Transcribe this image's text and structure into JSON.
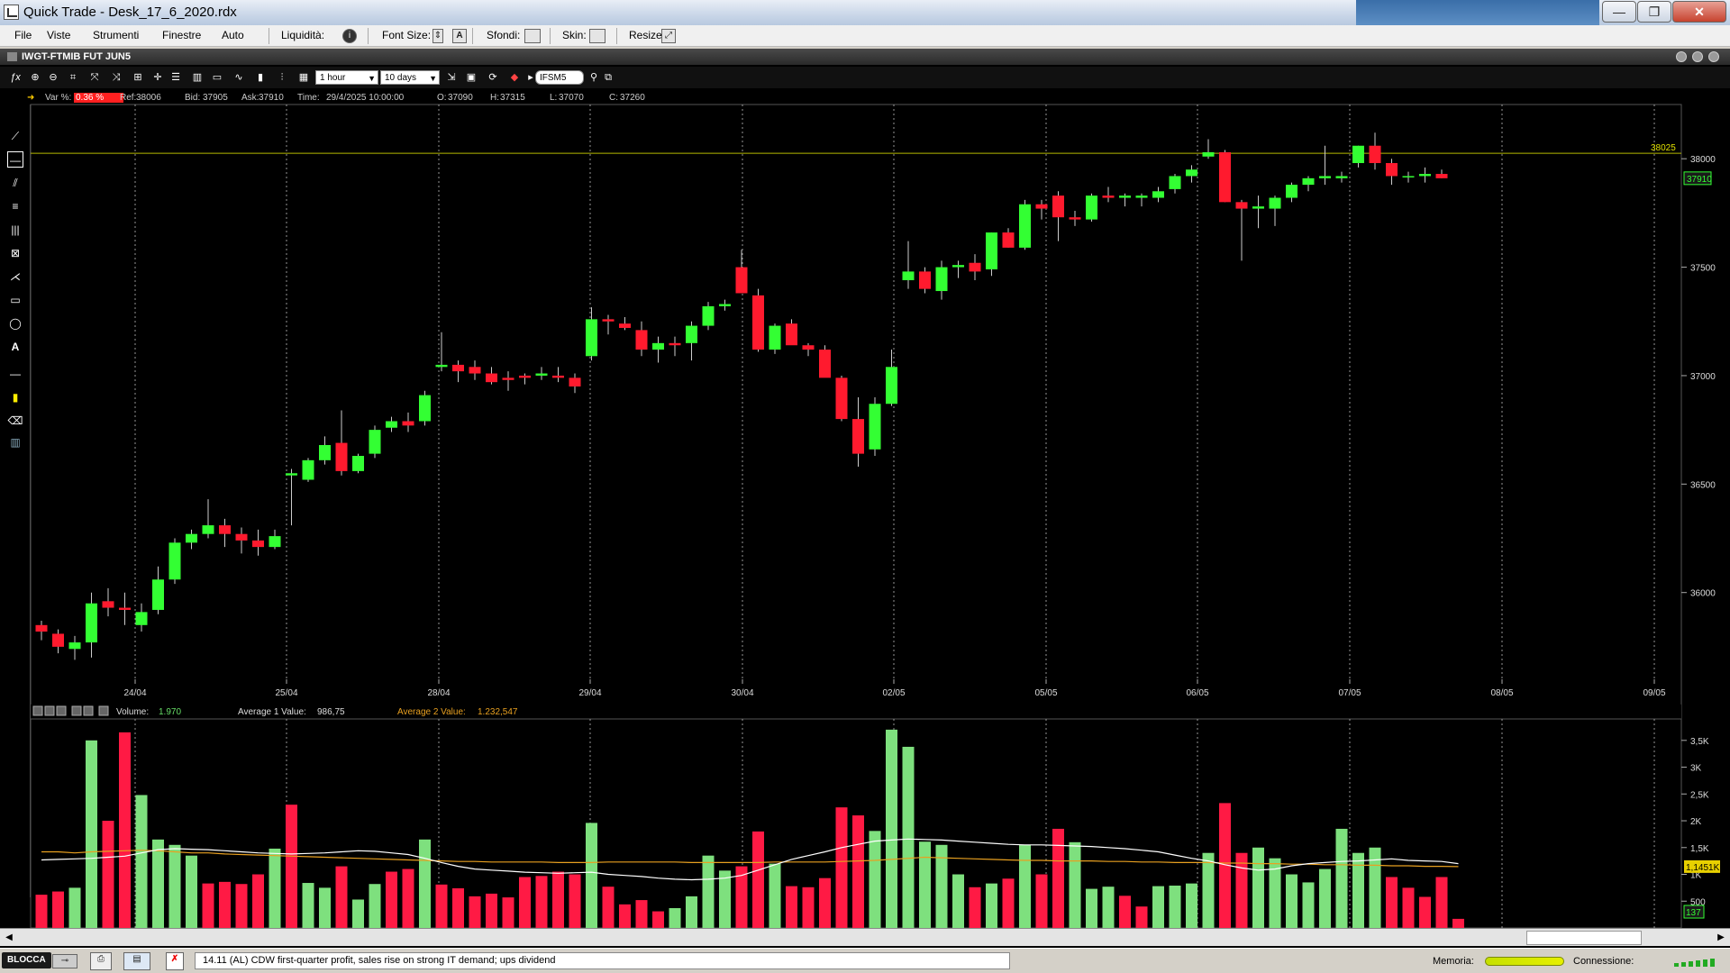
{
  "window": {
    "title": "Quick Trade - Desk_17_6_2020.rdx",
    "min_label": "—",
    "max_label": "❐",
    "close_label": "✕"
  },
  "menu": {
    "items": [
      "File",
      "Viste",
      "Strumenti",
      "Finestre",
      "Auto"
    ],
    "liquidita_label": "Liquidità:",
    "font_size_label": "Font Size:",
    "sfondi_label": "Sfondi:",
    "skin_label": "Skin:",
    "resize_label": "Resize:"
  },
  "chart_window": {
    "title": "IWGT-FTMIB FUT JUN5",
    "interval": "1 hour",
    "range": "10 days",
    "symbol": "IFSM5"
  },
  "info": {
    "var_label": "Var %:",
    "var_value": "0.36 %",
    "ref_label": "Ref:",
    "ref_value": "38006",
    "bid_label": "Bid:",
    "bid_value": "37905",
    "ask_label": "Ask:",
    "ask_value": "37910",
    "time_label": "Time:",
    "time_value": "29/4/2025 10:00:00",
    "o_label": "O:",
    "o_value": "37090",
    "h_label": "H:",
    "h_value": "37315",
    "l_label": "L:",
    "l_value": "37070",
    "c_label": "C:",
    "c_value": "37260"
  },
  "volume_info": {
    "volume_label": "Volume:",
    "volume_value": "1.970",
    "avg1_label": "Average 1 Value:",
    "avg1_value": "986,75",
    "avg2_label": "Average 2 Value:",
    "avg2_value": "1.232,547"
  },
  "colors": {
    "up": "#33ff33",
    "down": "#ff1a2e",
    "vol_up": "#7ee07e",
    "vol_down": "#ff1a44",
    "refline": "#b5b800",
    "avg1": "#ffffff",
    "avg2": "#e8a020"
  },
  "chart_data": [
    {
      "type": "candlestick",
      "y_ticks": [
        "38000",
        "37500",
        "37000",
        "36500",
        "36000"
      ],
      "ylim": [
        35600,
        38250
      ],
      "x_ticks": [
        "24/04",
        "25/04",
        "28/04",
        "29/04",
        "30/04",
        "02/05",
        "05/05",
        "06/05",
        "07/05",
        "08/05",
        "09/05"
      ],
      "ref_line": {
        "value": 38025,
        "label": "38025"
      },
      "last_price": {
        "value": 37910,
        "label": "37910"
      },
      "candles": [
        {
          "o": 35850,
          "h": 35870,
          "l": 35780,
          "c": 35820
        },
        {
          "o": 35810,
          "h": 35830,
          "l": 35720,
          "c": 35750
        },
        {
          "o": 35740,
          "h": 35800,
          "l": 35690,
          "c": 35770
        },
        {
          "o": 35770,
          "h": 36000,
          "l": 35700,
          "c": 35950
        },
        {
          "o": 35960,
          "h": 36020,
          "l": 35890,
          "c": 35930
        },
        {
          "o": 35930,
          "h": 36000,
          "l": 35850,
          "c": 35920
        },
        {
          "o": 35850,
          "h": 35950,
          "l": 35820,
          "c": 35910
        },
        {
          "o": 35920,
          "h": 36120,
          "l": 35900,
          "c": 36060
        },
        {
          "o": 36060,
          "h": 36250,
          "l": 36040,
          "c": 36230
        },
        {
          "o": 36230,
          "h": 36290,
          "l": 36200,
          "c": 36270
        },
        {
          "o": 36270,
          "h": 36430,
          "l": 36250,
          "c": 36310
        },
        {
          "o": 36310,
          "h": 36340,
          "l": 36210,
          "c": 36270
        },
        {
          "o": 36270,
          "h": 36300,
          "l": 36180,
          "c": 36240
        },
        {
          "o": 36240,
          "h": 36290,
          "l": 36170,
          "c": 36210
        },
        {
          "o": 36210,
          "h": 36290,
          "l": 36200,
          "c": 36260
        },
        {
          "o": 36540,
          "h": 36570,
          "l": 36310,
          "c": 36550
        },
        {
          "o": 36520,
          "h": 36620,
          "l": 36510,
          "c": 36610
        },
        {
          "o": 36610,
          "h": 36720,
          "l": 36590,
          "c": 36680
        },
        {
          "o": 36690,
          "h": 36840,
          "l": 36540,
          "c": 36560
        },
        {
          "o": 36560,
          "h": 36640,
          "l": 36550,
          "c": 36630
        },
        {
          "o": 36640,
          "h": 36770,
          "l": 36620,
          "c": 36750
        },
        {
          "o": 36760,
          "h": 36810,
          "l": 36740,
          "c": 36790
        },
        {
          "o": 36790,
          "h": 36830,
          "l": 36740,
          "c": 36770
        },
        {
          "o": 36790,
          "h": 36930,
          "l": 36770,
          "c": 36910
        },
        {
          "o": 37040,
          "h": 37200,
          "l": 37020,
          "c": 37050
        },
        {
          "o": 37050,
          "h": 37070,
          "l": 36970,
          "c": 37020
        },
        {
          "o": 37040,
          "h": 37070,
          "l": 36980,
          "c": 37010
        },
        {
          "o": 37010,
          "h": 37040,
          "l": 36960,
          "c": 36970
        },
        {
          "o": 36990,
          "h": 37020,
          "l": 36930,
          "c": 36980
        },
        {
          "o": 37000,
          "h": 37010,
          "l": 36960,
          "c": 36990
        },
        {
          "o": 37000,
          "h": 37040,
          "l": 36980,
          "c": 37010
        },
        {
          "o": 37000,
          "h": 37040,
          "l": 36970,
          "c": 36990
        },
        {
          "o": 36990,
          "h": 37010,
          "l": 36920,
          "c": 36950
        },
        {
          "o": 37090,
          "h": 37315,
          "l": 37070,
          "c": 37260
        },
        {
          "o": 37260,
          "h": 37280,
          "l": 37190,
          "c": 37250
        },
        {
          "o": 37240,
          "h": 37270,
          "l": 37210,
          "c": 37220
        },
        {
          "o": 37210,
          "h": 37250,
          "l": 37090,
          "c": 37120
        },
        {
          "o": 37120,
          "h": 37180,
          "l": 37060,
          "c": 37150
        },
        {
          "o": 37150,
          "h": 37180,
          "l": 37090,
          "c": 37140
        },
        {
          "o": 37150,
          "h": 37250,
          "l": 37070,
          "c": 37230
        },
        {
          "o": 37230,
          "h": 37340,
          "l": 37210,
          "c": 37320
        },
        {
          "o": 37320,
          "h": 37350,
          "l": 37300,
          "c": 37330
        },
        {
          "o": 37500,
          "h": 37580,
          "l": 37410,
          "c": 37380
        },
        {
          "o": 37370,
          "h": 37400,
          "l": 37110,
          "c": 37120
        },
        {
          "o": 37120,
          "h": 37240,
          "l": 37100,
          "c": 37230
        },
        {
          "o": 37240,
          "h": 37260,
          "l": 37160,
          "c": 37140
        },
        {
          "o": 37140,
          "h": 37150,
          "l": 37090,
          "c": 37120
        },
        {
          "o": 37120,
          "h": 37140,
          "l": 37050,
          "c": 36990
        },
        {
          "o": 36990,
          "h": 37000,
          "l": 36790,
          "c": 36800
        },
        {
          "o": 36800,
          "h": 36900,
          "l": 36580,
          "c": 36640
        },
        {
          "o": 36660,
          "h": 36900,
          "l": 36630,
          "c": 36870
        },
        {
          "o": 36870,
          "h": 37120,
          "l": 36860,
          "c": 37040
        },
        {
          "o": 37440,
          "h": 37620,
          "l": 37400,
          "c": 37480
        },
        {
          "o": 37480,
          "h": 37500,
          "l": 37380,
          "c": 37400
        },
        {
          "o": 37390,
          "h": 37530,
          "l": 37350,
          "c": 37500
        },
        {
          "o": 37500,
          "h": 37530,
          "l": 37450,
          "c": 37510
        },
        {
          "o": 37520,
          "h": 37560,
          "l": 37440,
          "c": 37480
        },
        {
          "o": 37490,
          "h": 37660,
          "l": 37460,
          "c": 37660
        },
        {
          "o": 37660,
          "h": 37680,
          "l": 37590,
          "c": 37590
        },
        {
          "o": 37590,
          "h": 37810,
          "l": 37580,
          "c": 37790
        },
        {
          "o": 37790,
          "h": 37810,
          "l": 37720,
          "c": 37770
        },
        {
          "o": 37830,
          "h": 37850,
          "l": 37620,
          "c": 37730
        },
        {
          "o": 37730,
          "h": 37760,
          "l": 37690,
          "c": 37720
        },
        {
          "o": 37720,
          "h": 37840,
          "l": 37710,
          "c": 37830
        },
        {
          "o": 37830,
          "h": 37870,
          "l": 37800,
          "c": 37820
        },
        {
          "o": 37820,
          "h": 37840,
          "l": 37780,
          "c": 37830
        },
        {
          "o": 37820,
          "h": 37840,
          "l": 37780,
          "c": 37830
        },
        {
          "o": 37820,
          "h": 37870,
          "l": 37800,
          "c": 37850
        },
        {
          "o": 37860,
          "h": 37930,
          "l": 37840,
          "c": 37920
        },
        {
          "o": 37920,
          "h": 37970,
          "l": 37890,
          "c": 37950
        },
        {
          "o": 38010,
          "h": 38090,
          "l": 38000,
          "c": 38030
        },
        {
          "o": 38030,
          "h": 38040,
          "l": 37800,
          "c": 37800
        },
        {
          "o": 37800,
          "h": 37810,
          "l": 37530,
          "c": 37770
        },
        {
          "o": 37770,
          "h": 37830,
          "l": 37680,
          "c": 37780
        },
        {
          "o": 37770,
          "h": 37830,
          "l": 37690,
          "c": 37820
        },
        {
          "o": 37820,
          "h": 37890,
          "l": 37800,
          "c": 37880
        },
        {
          "o": 37880,
          "h": 37920,
          "l": 37850,
          "c": 37910
        },
        {
          "o": 37910,
          "h": 38060,
          "l": 37880,
          "c": 37920
        },
        {
          "o": 37910,
          "h": 37940,
          "l": 37890,
          "c": 37920
        },
        {
          "o": 37980,
          "h": 38060,
          "l": 37960,
          "c": 38060
        },
        {
          "o": 38060,
          "h": 38120,
          "l": 37950,
          "c": 37980
        },
        {
          "o": 37980,
          "h": 38000,
          "l": 37880,
          "c": 37920
        },
        {
          "o": 37920,
          "h": 37940,
          "l": 37890,
          "c": 37920
        },
        {
          "o": 37920,
          "h": 37960,
          "l": 37890,
          "c": 37930
        },
        {
          "o": 37930,
          "h": 37950,
          "l": 37910,
          "c": 37910
        }
      ]
    },
    {
      "type": "bar",
      "y_ticks": [
        "3,5K",
        "3K",
        "2,5K",
        "2K",
        "1,5K",
        "1K",
        "500"
      ],
      "ylim": [
        0,
        3900
      ],
      "avg2_label": "1,1451K",
      "last_label": "137",
      "volumes": [
        620,
        680,
        750,
        3500,
        2000,
        3650,
        2480,
        1650,
        1550,
        1350,
        830,
        860,
        820,
        1000,
        1480,
        2300,
        840,
        750,
        1150,
        530,
        820,
        1050,
        1100,
        1650,
        810,
        740,
        590,
        640,
        570,
        950,
        970,
        1050,
        1000,
        1960,
        770,
        440,
        520,
        310,
        370,
        590,
        1350,
        1070,
        1150,
        1800,
        1200,
        780,
        760,
        930,
        2250,
        2100,
        1810,
        3700,
        3380,
        1610,
        1550,
        1000,
        760,
        830,
        920,
        1550,
        1000,
        1850,
        1600,
        730,
        770,
        600,
        400,
        780,
        790,
        830,
        1400,
        2330,
        1400,
        1500,
        1300,
        1000,
        850,
        1100,
        1850,
        1400,
        1500,
        950,
        750,
        580,
        950,
        170
      ],
      "up": [
        0,
        0,
        1,
        1,
        0,
        0,
        1,
        1,
        1,
        1,
        0,
        0,
        0,
        0,
        1,
        0,
        1,
        1,
        0,
        1,
        1,
        0,
        0,
        1,
        0,
        0,
        0,
        0,
        0,
        0,
        0,
        0,
        0,
        1,
        0,
        0,
        0,
        0,
        1,
        1,
        1,
        1,
        0,
        0,
        1,
        0,
        0,
        0,
        0,
        0,
        1,
        1,
        1,
        1,
        1,
        1,
        0,
        1,
        0,
        1,
        0,
        0,
        1,
        1,
        1,
        0,
        0,
        1,
        1,
        1,
        1,
        0,
        0,
        1,
        1,
        1,
        1,
        1,
        1,
        1,
        1,
        0,
        0,
        0,
        0,
        0
      ],
      "avg1": [
        1270,
        1280,
        1290,
        1300,
        1320,
        1340,
        1400,
        1460,
        1480,
        1470,
        1460,
        1440,
        1420,
        1400,
        1390,
        1380,
        1390,
        1400,
        1420,
        1440,
        1430,
        1400,
        1370,
        1300,
        1220,
        1150,
        1100,
        1080,
        1060,
        1040,
        1030,
        1020,
        1030,
        1040,
        1000,
        980,
        960,
        930,
        910,
        900,
        910,
        930,
        980,
        1080,
        1180,
        1280,
        1350,
        1420,
        1500,
        1560,
        1620,
        1640,
        1660,
        1650,
        1640,
        1620,
        1600,
        1580,
        1560,
        1550,
        1550,
        1540,
        1530,
        1520,
        1500,
        1480,
        1450,
        1420,
        1360,
        1300,
        1250,
        1180,
        1120,
        1080,
        1100,
        1160,
        1200,
        1220,
        1240,
        1250,
        1270,
        1290,
        1260,
        1250,
        1240,
        1200
      ],
      "avg2": [
        1420,
        1420,
        1400,
        1420,
        1430,
        1440,
        1450,
        1440,
        1420,
        1400,
        1400,
        1380,
        1370,
        1360,
        1350,
        1340,
        1330,
        1320,
        1310,
        1300,
        1290,
        1280,
        1270,
        1260,
        1250,
        1240,
        1240,
        1230,
        1230,
        1230,
        1230,
        1220,
        1220,
        1220,
        1230,
        1230,
        1230,
        1230,
        1230,
        1220,
        1220,
        1220,
        1220,
        1220,
        1230,
        1230,
        1230,
        1230,
        1240,
        1250,
        1260,
        1280,
        1300,
        1320,
        1310,
        1300,
        1290,
        1280,
        1270,
        1260,
        1260,
        1250,
        1250,
        1250,
        1240,
        1240,
        1230,
        1230,
        1220,
        1220,
        1220,
        1210,
        1210,
        1200,
        1200,
        1190,
        1190,
        1180,
        1180,
        1170,
        1170,
        1160,
        1160,
        1150,
        1150,
        1145
      ]
    }
  ],
  "news": {
    "text": "14.11 (AL) CDW first-quarter profit, sales rise on strong IT demand; ups dividend"
  },
  "status": {
    "blocca_label": "BLOCCA",
    "memoria_label": "Memoria:",
    "connessione_label": "Connessione:"
  }
}
